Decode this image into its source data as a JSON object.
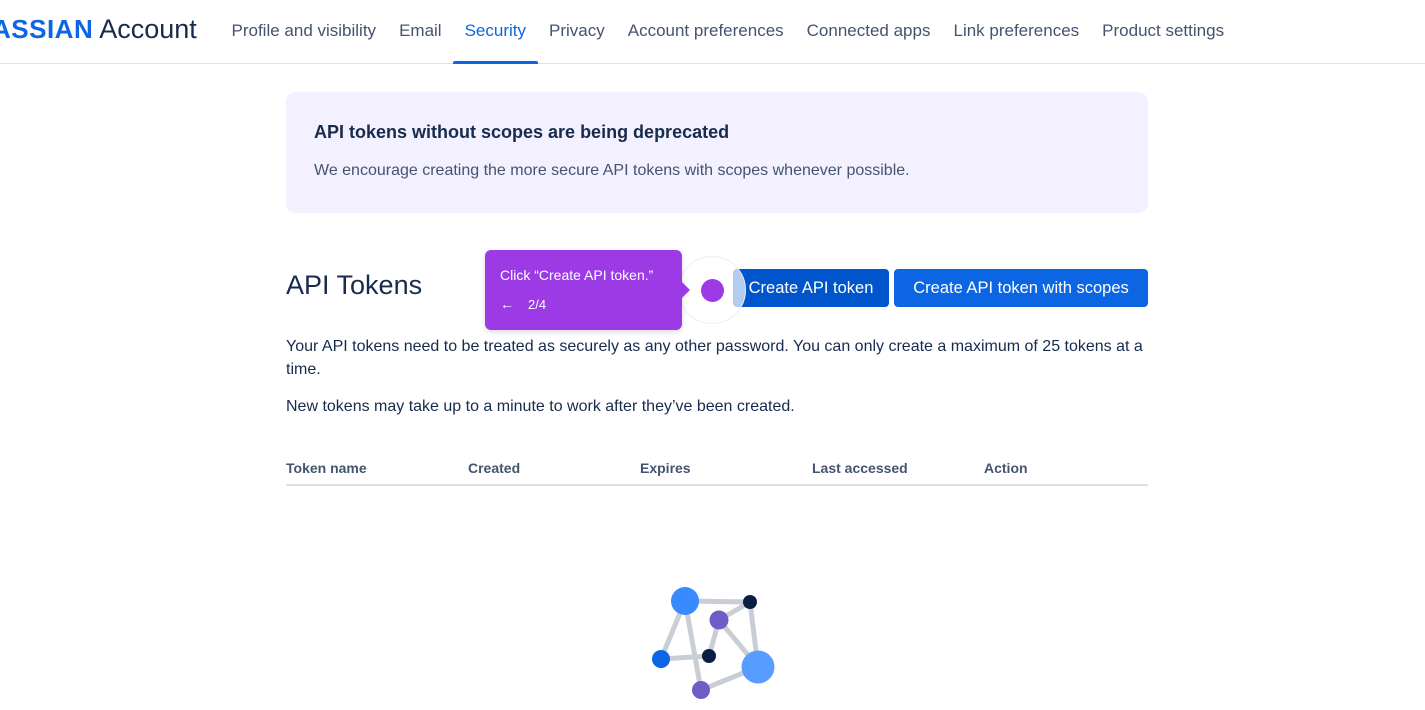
{
  "header": {
    "brand_strong": "ASSIAN",
    "brand_light": "Account",
    "nav": [
      {
        "label": "Profile and visibility"
      },
      {
        "label": "Email"
      },
      {
        "label": "Security",
        "active": true
      },
      {
        "label": "Privacy"
      },
      {
        "label": "Account preferences"
      },
      {
        "label": "Connected apps"
      },
      {
        "label": "Link preferences"
      },
      {
        "label": "Product settings"
      }
    ]
  },
  "banner": {
    "title": "API tokens without scopes are being deprecated",
    "text": "We encourage creating the more secure API tokens with scopes whenever possible."
  },
  "tokens": {
    "title": "API Tokens",
    "create_label": "Create API token",
    "create_scopes_label": "Create API token with scopes",
    "description_1": "Your API tokens need to be treated as securely as any other password. You can only create a maximum of 25 tokens at a time.",
    "description_2": "New tokens may take up to a minute to work after they’ve been created.",
    "columns": [
      "Token name",
      "Created",
      "Expires",
      "Last accessed",
      "Action"
    ]
  },
  "guide": {
    "text": "Click “Create API token.”",
    "back_icon": "arrow-left-icon",
    "step": "2/4"
  },
  "colors": {
    "accent": "#0c66e4",
    "guide": "#9c3ae6",
    "banner_bg": "#f3f0ff"
  }
}
